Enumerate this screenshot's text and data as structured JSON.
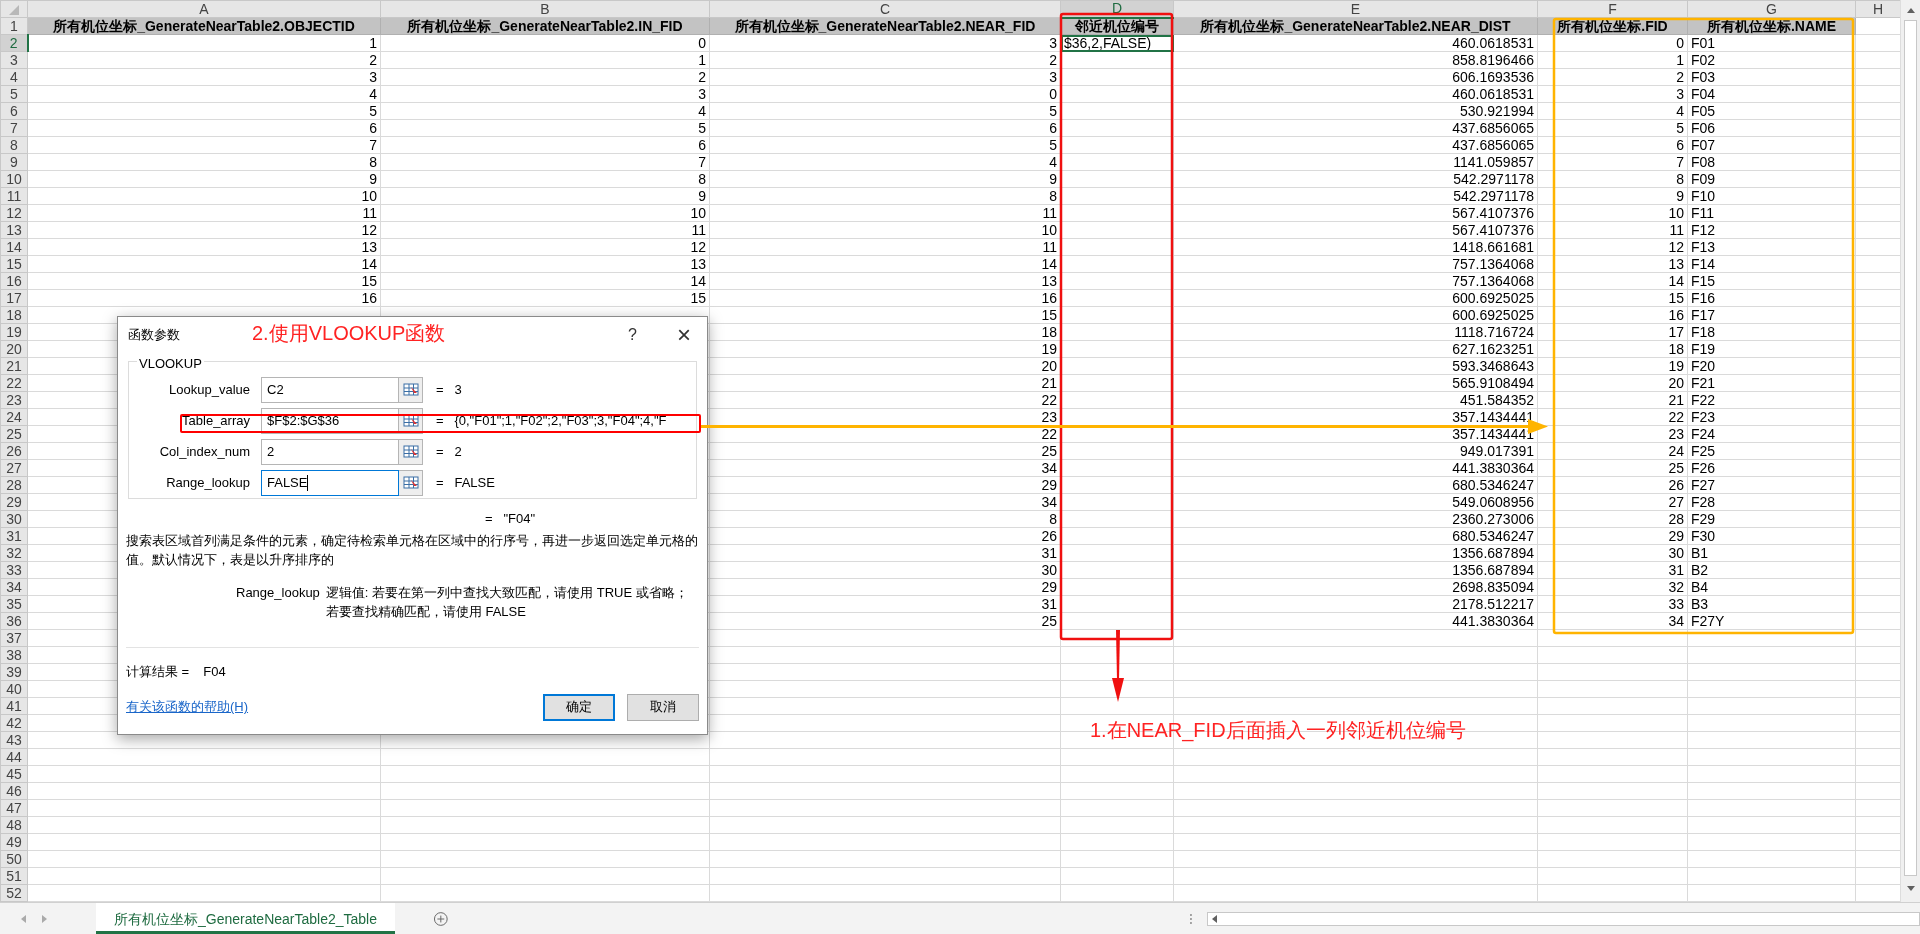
{
  "columns": [
    {
      "letter": "A",
      "selected": false
    },
    {
      "letter": "B",
      "selected": false
    },
    {
      "letter": "C",
      "selected": false
    },
    {
      "letter": "D",
      "selected": true
    },
    {
      "letter": "E",
      "selected": false
    },
    {
      "letter": "F",
      "selected": false
    },
    {
      "letter": "G",
      "selected": false
    },
    {
      "letter": "H",
      "selected": false
    }
  ],
  "header_row": {
    "number": "1",
    "cells": [
      "所有机位坐标_GenerateNearTable2.OBJECTID",
      "所有机位坐标_GenerateNearTable2.IN_FID",
      "所有机位坐标_GenerateNearTable2.NEAR_FID",
      "邻近机位编号",
      "所有机位坐标_GenerateNearTable2.NEAR_DIST",
      "所有机位坐标.FID",
      "所有机位坐标.NAME"
    ]
  },
  "rows": [
    {
      "number": "2",
      "selected": true,
      "a": "1",
      "b": "0",
      "c": "3",
      "d": "$36,2,FALSE)",
      "e": "460.0618531",
      "f": "0",
      "g": "F01"
    },
    {
      "number": "3",
      "selected": false,
      "a": "2",
      "b": "1",
      "c": "2",
      "e": "858.8196466",
      "f": "1",
      "g": "F02"
    },
    {
      "number": "4",
      "selected": false,
      "a": "3",
      "b": "2",
      "c": "3",
      "e": "606.1693536",
      "f": "2",
      "g": "F03"
    },
    {
      "number": "5",
      "selected": false,
      "a": "4",
      "b": "3",
      "c": "0",
      "e": "460.0618531",
      "f": "3",
      "g": "F04"
    },
    {
      "number": "6",
      "selected": false,
      "a": "5",
      "b": "4",
      "c": "5",
      "e": "530.921994",
      "f": "4",
      "g": "F05"
    },
    {
      "number": "7",
      "selected": false,
      "a": "6",
      "b": "5",
      "c": "6",
      "e": "437.6856065",
      "f": "5",
      "g": "F06"
    },
    {
      "number": "8",
      "selected": false,
      "a": "7",
      "b": "6",
      "c": "5",
      "e": "437.6856065",
      "f": "6",
      "g": "F07"
    },
    {
      "number": "9",
      "selected": false,
      "a": "8",
      "b": "7",
      "c": "4",
      "e": "1141.059857",
      "f": "7",
      "g": "F08"
    },
    {
      "number": "10",
      "selected": false,
      "a": "9",
      "b": "8",
      "c": "9",
      "e": "542.2971178",
      "f": "8",
      "g": "F09"
    },
    {
      "number": "11",
      "selected": false,
      "a": "10",
      "b": "9",
      "c": "8",
      "e": "542.2971178",
      "f": "9",
      "g": "F10"
    },
    {
      "number": "12",
      "selected": false,
      "a": "11",
      "b": "10",
      "c": "11",
      "e": "567.4107376",
      "f": "10",
      "g": "F11"
    },
    {
      "number": "13",
      "selected": false,
      "a": "12",
      "b": "11",
      "c": "10",
      "e": "567.4107376",
      "f": "11",
      "g": "F12"
    },
    {
      "number": "14",
      "selected": false,
      "a": "13",
      "b": "12",
      "c": "11",
      "e": "1418.661681",
      "f": "12",
      "g": "F13"
    },
    {
      "number": "15",
      "selected": false,
      "a": "14",
      "b": "13",
      "c": "14",
      "e": "757.1364068",
      "f": "13",
      "g": "F14"
    },
    {
      "number": "16",
      "selected": false,
      "a": "15",
      "b": "14",
      "c": "13",
      "e": "757.1364068",
      "f": "14",
      "g": "F15"
    },
    {
      "number": "17",
      "selected": false,
      "a": "16",
      "b": "15",
      "c": "16",
      "e": "600.6925025",
      "f": "15",
      "g": "F16"
    },
    {
      "number": "18",
      "selected": false,
      "c": "15",
      "e": "600.6925025",
      "f": "16",
      "g": "F17"
    },
    {
      "number": "19",
      "selected": false,
      "c": "18",
      "e": "1118.716724",
      "f": "17",
      "g": "F18"
    },
    {
      "number": "20",
      "selected": false,
      "c": "19",
      "e": "627.1623251",
      "f": "18",
      "g": "F19"
    },
    {
      "number": "21",
      "selected": false,
      "c": "20",
      "e": "593.3468643",
      "f": "19",
      "g": "F20"
    },
    {
      "number": "22",
      "selected": false,
      "c": "21",
      "e": "565.9108494",
      "f": "20",
      "g": "F21"
    },
    {
      "number": "23",
      "selected": false,
      "c": "22",
      "e": "451.584352",
      "f": "21",
      "g": "F22"
    },
    {
      "number": "24",
      "selected": false,
      "c": "23",
      "e": "357.1434441",
      "f": "22",
      "g": "F23"
    },
    {
      "number": "25",
      "selected": false,
      "c": "22",
      "e": "357.1434441",
      "f": "23",
      "g": "F24"
    },
    {
      "number": "26",
      "selected": false,
      "c": "25",
      "e": "949.017391",
      "f": "24",
      "g": "F25"
    },
    {
      "number": "27",
      "selected": false,
      "c": "34",
      "e": "441.3830364",
      "f": "25",
      "g": "F26"
    },
    {
      "number": "28",
      "selected": false,
      "c": "29",
      "e": "680.5346247",
      "f": "26",
      "g": "F27"
    },
    {
      "number": "29",
      "selected": false,
      "c": "34",
      "e": "549.0608956",
      "f": "27",
      "g": "F28"
    },
    {
      "number": "30",
      "selected": false,
      "c": "8",
      "e": "2360.273006",
      "f": "28",
      "g": "F29"
    },
    {
      "number": "31",
      "selected": false,
      "c": "26",
      "e": "680.5346247",
      "f": "29",
      "g": "F30"
    },
    {
      "number": "32",
      "selected": false,
      "c": "31",
      "e": "1356.687894",
      "f": "30",
      "g": "B1"
    },
    {
      "number": "33",
      "selected": false,
      "c": "30",
      "e": "1356.687894",
      "f": "31",
      "g": "B2"
    },
    {
      "number": "34",
      "selected": false,
      "c": "29",
      "e": "2698.835094",
      "f": "32",
      "g": "B4"
    },
    {
      "number": "35",
      "selected": false,
      "c": "31",
      "e": "2178.512217",
      "f": "33",
      "g": "B3"
    },
    {
      "number": "36",
      "selected": false,
      "c": "25",
      "e": "441.3830364",
      "f": "34",
      "g": "F27Y"
    },
    {
      "number": "37",
      "selected": false
    },
    {
      "number": "38",
      "selected": false
    },
    {
      "number": "39",
      "selected": false
    },
    {
      "number": "40",
      "selected": false
    },
    {
      "number": "41",
      "selected": false
    },
    {
      "number": "42",
      "selected": false
    },
    {
      "number": "43",
      "selected": false
    },
    {
      "number": "44",
      "selected": false
    },
    {
      "number": "45",
      "selected": false
    },
    {
      "number": "46",
      "selected": false
    },
    {
      "number": "47",
      "selected": false
    },
    {
      "number": "48",
      "selected": false
    },
    {
      "number": "49",
      "selected": false
    },
    {
      "number": "50",
      "selected": false
    },
    {
      "number": "51",
      "selected": false
    },
    {
      "number": "52",
      "selected": false
    }
  ],
  "dialog": {
    "title": "函数参数",
    "help": "?",
    "close": "×",
    "function": "VLOOKUP",
    "arguments": [
      {
        "label": "Lookup_value",
        "value": "C2",
        "result": "=   3",
        "focused": false
      },
      {
        "label": "Table_array",
        "value": "$F$2:$G$36",
        "result": "=   {0,\"F01\";1,\"F02\";2,\"F03\";3,\"F04\";4,\"F",
        "focused": false
      },
      {
        "label": "Col_index_num",
        "value": "2",
        "result": "=   2",
        "focused": false
      },
      {
        "label": "Range_lookup",
        "value": "FALSE",
        "result": "=   FALSE",
        "focused": true
      }
    ],
    "formula_result": "=   \"F04\"",
    "description": "搜索表区域首列满足条件的元素，确定待检索单元格在区域中的行序号，再进一步返回选定单元格的值。默认情况下，表是以升序排序的",
    "param_name": "Range_lookup",
    "param_description": "逻辑值: 若要在第一列中查找大致匹配，请使用 TRUE 或省略；若要查找精确匹配，请使用 FALSE",
    "result_label": "计算结果 =",
    "result_value": "F04",
    "help_link": "有关该函数的帮助(H)",
    "buttons": [
      {
        "label": "确定",
        "kind": "default"
      },
      {
        "label": "取消",
        "kind": "normal"
      }
    ]
  },
  "notes": [
    "2.使用VLOOKUP函数",
    "1.在NEAR_FID后面插入一列邻近机位编号"
  ],
  "sheet_tabs": [
    {
      "label": "所有机位坐标_GenerateNearTable2_Table",
      "selected": true
    }
  ]
}
